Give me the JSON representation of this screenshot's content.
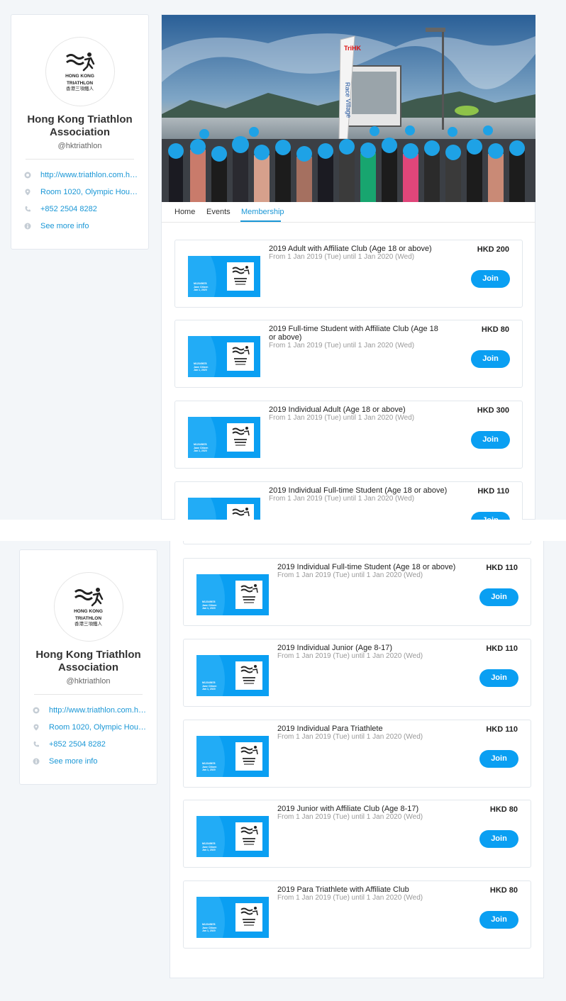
{
  "org": {
    "logo_en_line1": "HONG KONG",
    "logo_en_line2": "TRIATHLON",
    "logo_zh": "香港三項鐵人",
    "name": "Hong Kong Triathlon Association",
    "handle": "@hktriathlon",
    "info": [
      {
        "icon": "globe-icon",
        "text": "http://www.triathlon.com.hk/..."
      },
      {
        "icon": "location-pin-icon",
        "text": "Room 1020, Olympic House,..."
      },
      {
        "icon": "phone-icon",
        "text": "+852 2504 8282"
      },
      {
        "icon": "info-icon",
        "text": "See more info"
      }
    ]
  },
  "hero": {
    "banner_text": "TriHK",
    "sign_text": "Race Village"
  },
  "tabs": [
    {
      "label": "Home",
      "active": false
    },
    {
      "label": "Events",
      "active": false
    },
    {
      "label": "Membership",
      "active": true
    }
  ],
  "card_thumb": {
    "id_line1": "M12345678",
    "id_line2": "Jane Citizen",
    "id_line3": "Jan 1, 2020",
    "logo_en_line1": "HONG KONG",
    "logo_en_line2": "TRIATHLON",
    "logo_zh": "香港三項鐵人"
  },
  "memberships_view1": [
    {
      "title": "2019 Adult with Affiliate Club (Age 18 or above)",
      "date": "From 1 Jan 2019 (Tue) until 1 Jan 2020 (Wed)",
      "price": "HKD 200",
      "join": "Join"
    },
    {
      "title": "2019 Full-time Student with Affiliate Club (Age 18 or above)",
      "date": "From 1 Jan 2019 (Tue) until 1 Jan 2020 (Wed)",
      "price": "HKD 80",
      "join": "Join"
    },
    {
      "title": "2019 Individual Adult (Age 18 or above)",
      "date": "From 1 Jan 2019 (Tue) until 1 Jan 2020 (Wed)",
      "price": "HKD 300",
      "join": "Join"
    },
    {
      "title": "2019 Individual Full-time Student (Age 18 or above)",
      "date": "From 1 Jan 2019 (Tue) until 1 Jan 2020 (Wed)",
      "price": "HKD 110",
      "join": "Join"
    }
  ],
  "memberships_view2": [
    {
      "title": "2019 Individual Full-time Student (Age 18 or above)",
      "date": "From 1 Jan 2019 (Tue) until 1 Jan 2020 (Wed)",
      "price": "HKD 110",
      "join": "Join"
    },
    {
      "title": "2019 Individual Junior (Age 8-17)",
      "date": "From 1 Jan 2019 (Tue) until 1 Jan 2020 (Wed)",
      "price": "HKD 110",
      "join": "Join"
    },
    {
      "title": "2019 Individual Para Triathlete",
      "date": "From 1 Jan 2019 (Tue) until 1 Jan 2020 (Wed)",
      "price": "HKD 110",
      "join": "Join"
    },
    {
      "title": "2019 Junior with Affiliate Club (Age 8-17)",
      "date": "From 1 Jan 2019 (Tue) until 1 Jan 2020 (Wed)",
      "price": "HKD 80",
      "join": "Join"
    },
    {
      "title": "2019 Para Triathlete with Affiliate Club",
      "date": "From 1 Jan 2019 (Tue) until 1 Jan 2020 (Wed)",
      "price": "HKD 80",
      "join": "Join"
    }
  ],
  "colors": {
    "accent": "#0a9ff2",
    "link": "#1a97d6",
    "page_bg": "#f3f6f9"
  }
}
